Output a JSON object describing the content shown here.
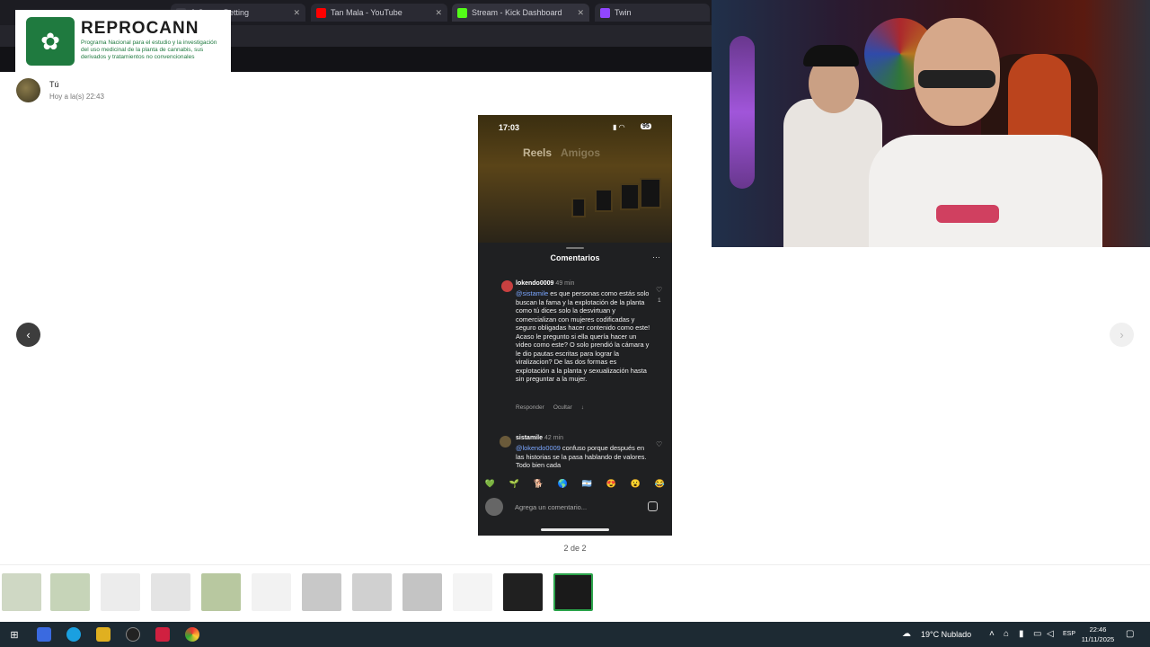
{
  "browser": {
    "tabs": [
      {
        "label": "& Sports Betting",
        "icon": "betting-icon",
        "color": "#3a3a44"
      },
      {
        "label": "Tan Mala - YouTube",
        "icon": "youtube-icon",
        "color": "#ff0000"
      },
      {
        "label": "Stream - Kick Dashboard",
        "icon": "kick-icon",
        "color": "#53fc18"
      },
      {
        "label": "Twin",
        "icon": "twitch-icon",
        "color": "#9146ff"
      }
    ]
  },
  "overlay": {
    "title": "REPROCANN",
    "subtitle": "Programa Nacional para el estudio y la investigación del uso medicinal de la planta de cannabis, sus derivados y tratamientos no convencionales",
    "brand_color": "#1f7a3f"
  },
  "viewer": {
    "user_name": "Tú",
    "user_time": "Hoy a la(s) 22:43",
    "counter": "2 de 2",
    "prev_icon": "‹",
    "next_icon": "›"
  },
  "phone": {
    "status_time": "17:03",
    "battery": "95",
    "tab_reels": "Reels",
    "tab_friends": "Amigos",
    "sheet_title": "Comentarios",
    "more_icon": "···",
    "comments": [
      {
        "user": "lokendo0009",
        "time": "49 min",
        "mention": "@sistamile",
        "text": " es que personas como estás solo buscan la fama y la explotación de la planta como tú dices solo la desvirtuan y comercializan con mujeres codificadas y seguro obligadas hacer contenido como este! Acaso le pregunto si ella quería hacer un video como este? O solo prendió la cámara y le dio pautas escritas para lograr la viralizacion? De las dos formas es explotación a la planta y sexualización hasta sin preguntar a la mujer.",
        "likes": "1",
        "reply": "Responder",
        "hide": "Ocultar"
      },
      {
        "user": "sistamile",
        "time": "42 min",
        "mention": "@lokendo0009",
        "text": " confuso porque después en las historias se la pasa hablando de valores. Todo bien cada"
      }
    ],
    "emojis": [
      "💚",
      "🌱",
      "🐕",
      "🌎",
      "🇦🇷",
      "😍",
      "😮",
      "😂"
    ],
    "composer_placeholder": "Agrega un comentario..."
  },
  "taskbar": {
    "weather": "19°C Nublado",
    "lang": "ESP",
    "time": "22:46",
    "date": "11/11/2025"
  }
}
